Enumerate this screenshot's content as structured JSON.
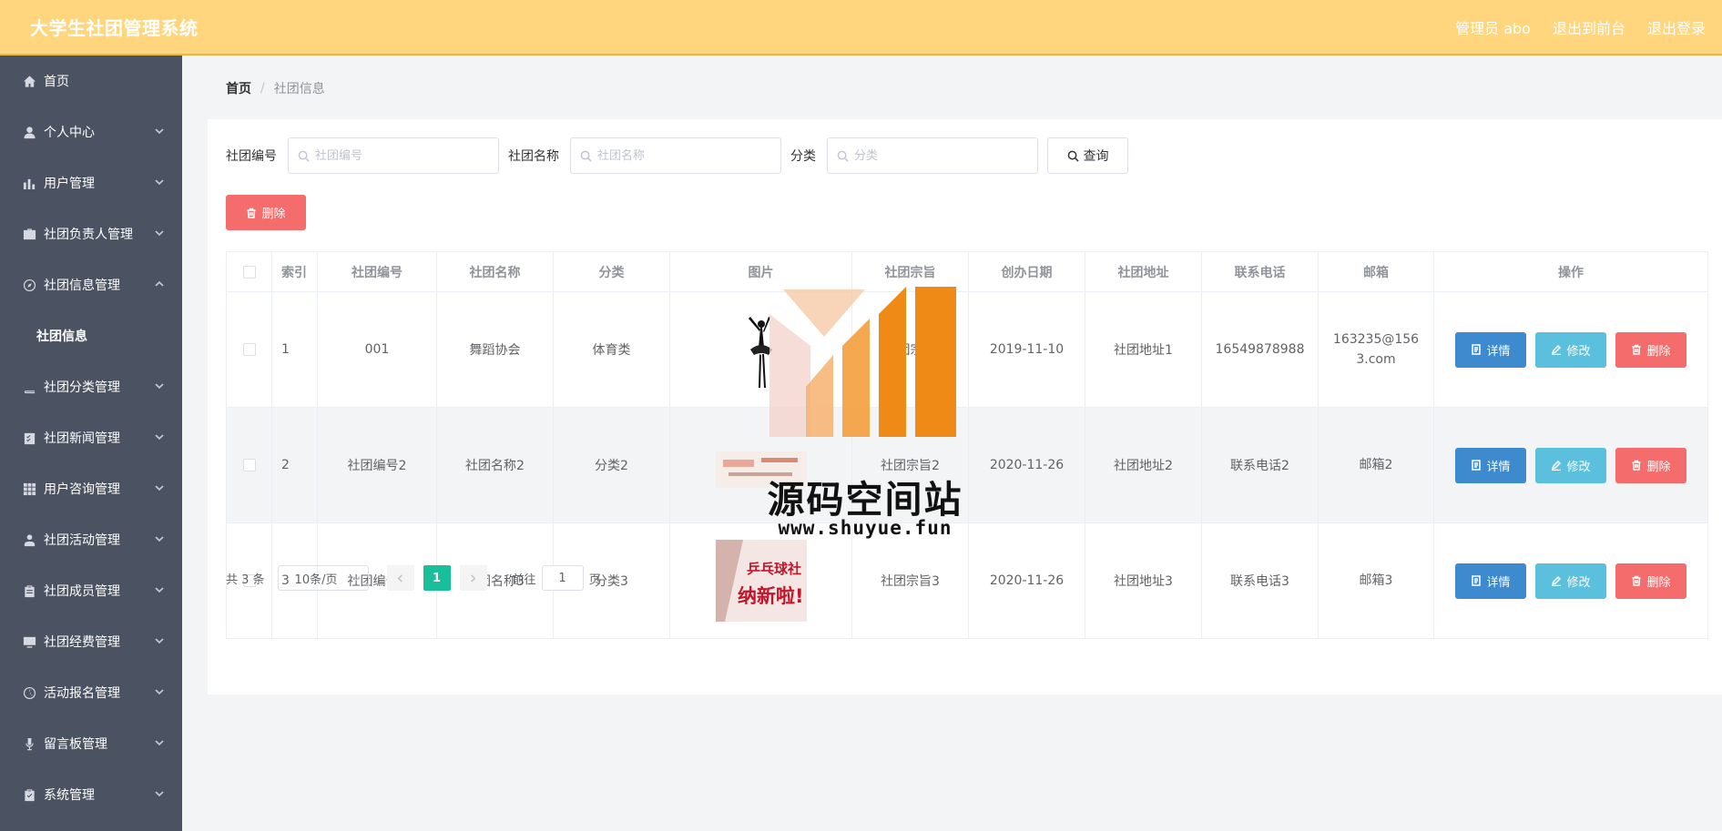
{
  "header": {
    "app_title": "大学生社团管理系统",
    "admin_label": "管理员 abo",
    "front_label": "退出到前台",
    "logout_label": "退出登录"
  },
  "sidebar": {
    "items": [
      {
        "label": "首页",
        "icon": "home-icon"
      },
      {
        "label": "个人中心",
        "icon": "user-icon"
      },
      {
        "label": "用户管理",
        "icon": "bar-chart-icon"
      },
      {
        "label": "社团负责人管理",
        "icon": "briefcase-icon"
      },
      {
        "label": "社团信息管理",
        "icon": "compass-icon"
      },
      {
        "label": "社团信息",
        "icon": ""
      },
      {
        "label": "社团分类管理",
        "icon": "book-icon"
      },
      {
        "label": "社团新闻管理",
        "icon": "checklist-icon"
      },
      {
        "label": "用户咨询管理",
        "icon": "grid-icon"
      },
      {
        "label": "社团活动管理",
        "icon": "person-icon"
      },
      {
        "label": "社团成员管理",
        "icon": "clipboard-icon"
      },
      {
        "label": "社团经费管理",
        "icon": "monitor-icon"
      },
      {
        "label": "活动报名管理",
        "icon": "gauge-icon"
      },
      {
        "label": "留言板管理",
        "icon": "mic-icon"
      },
      {
        "label": "系统管理",
        "icon": "clipboard-check-icon"
      }
    ]
  },
  "breadcrumb": {
    "home": "首页",
    "separator": "/",
    "current": "社团信息"
  },
  "search": {
    "code_label": "社团编号",
    "code_placeholder": "社团编号",
    "name_label": "社团名称",
    "name_placeholder": "社团名称",
    "category_label": "分类",
    "category_placeholder": "分类",
    "query_label": "查询"
  },
  "toolbar": {
    "delete_label": "删除"
  },
  "table": {
    "headers": [
      "索引",
      "社团编号",
      "社团名称",
      "分类",
      "图片",
      "社团宗旨",
      "创办日期",
      "社团地址",
      "联系电话",
      "邮箱",
      "操作"
    ],
    "rows": [
      {
        "index": "1",
        "code": "001",
        "name": "舞蹈协会",
        "category": "体育类",
        "purpose": "社团宗旨",
        "date": "2019-11-10",
        "address": "社团地址1",
        "phone": "16549878988",
        "email": "163235@1563.com"
      },
      {
        "index": "2",
        "code": "社团编号2",
        "name": "社团名称2",
        "category": "分类2",
        "purpose": "社团宗旨2",
        "date": "2020-11-26",
        "address": "社团地址2",
        "phone": "联系电话2",
        "email": "邮箱2"
      },
      {
        "index": "3",
        "code": "社团编号3",
        "name": "社团名称3",
        "category": "分类3",
        "purpose": "社团宗旨3",
        "date": "2020-11-26",
        "address": "社团地址3",
        "phone": "联系电话3",
        "email": "邮箱3"
      }
    ],
    "actions": {
      "detail": "详情",
      "edit": "修改",
      "delete": "删除"
    },
    "poster_text_1": "乒乓球社",
    "poster_text_2": "纳新啦!"
  },
  "pagination": {
    "total": "共 3 条",
    "page_size": "10条/页",
    "current_page": "1",
    "goto_prefix": "前往",
    "goto_value": "1",
    "goto_suffix": "页"
  },
  "watermark": {
    "text": "源码空间站",
    "url": "www.shuyue.fun"
  },
  "colors": {
    "header": "#ffd67e",
    "sidebar": "#4b5262",
    "detail": "#3d8bce",
    "edit": "#5bc0de",
    "danger": "#f56c6c",
    "page_active": "#19be9a"
  }
}
